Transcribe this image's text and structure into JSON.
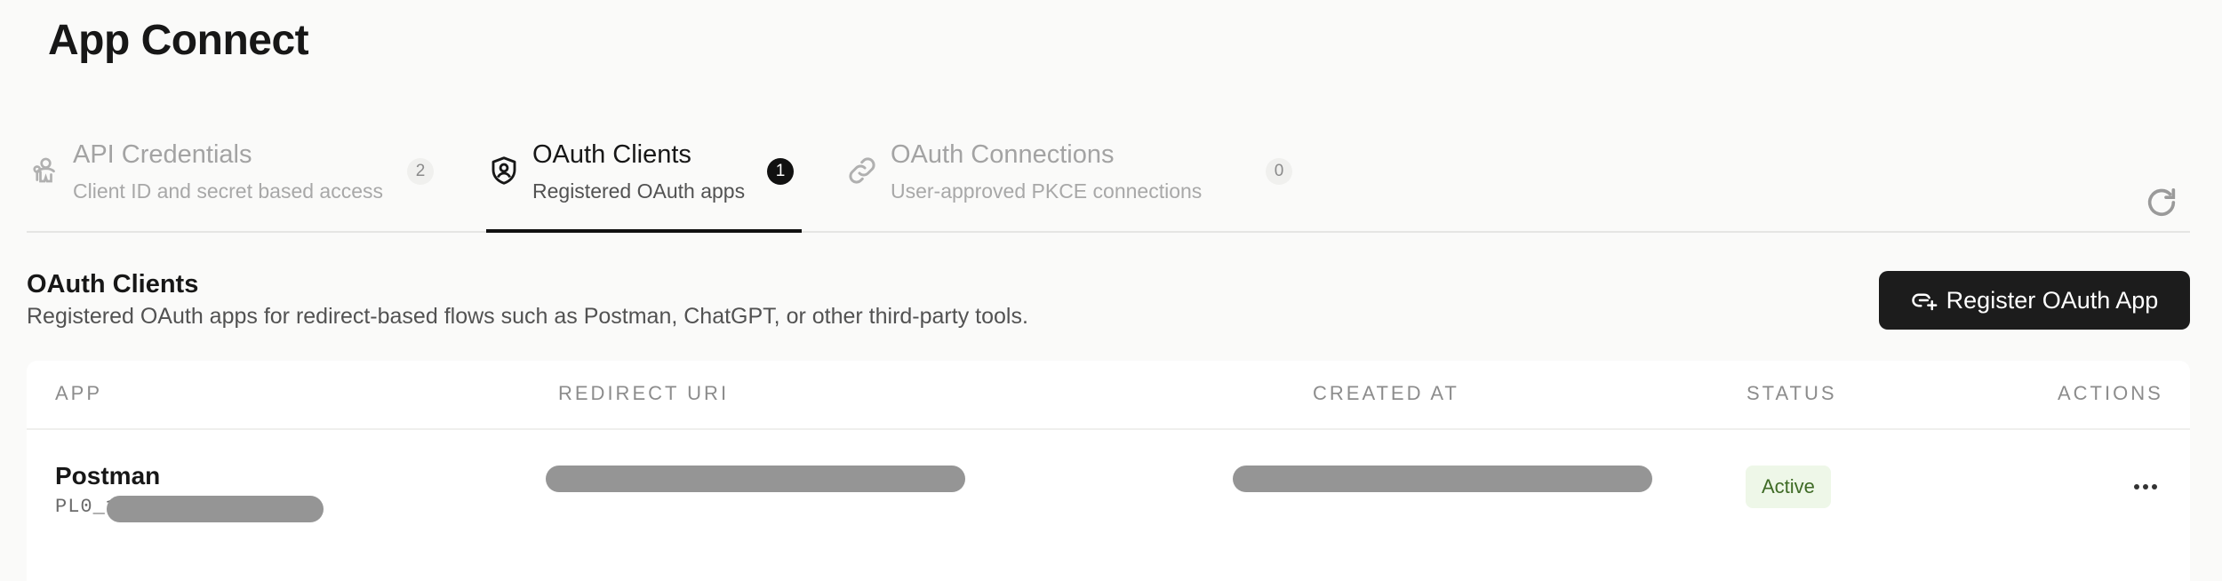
{
  "page": {
    "title": "App Connect"
  },
  "tabs": [
    {
      "title": "API Credentials",
      "subtitle": "Client ID and secret based access",
      "count": "2",
      "icon": "key-person-icon",
      "active": false
    },
    {
      "title": "OAuth Clients",
      "subtitle": "Registered OAuth apps",
      "count": "1",
      "icon": "shield-user-icon",
      "active": true
    },
    {
      "title": "OAuth Connections",
      "subtitle": "User-approved PKCE connections",
      "count": "0",
      "icon": "link-icon",
      "active": false
    }
  ],
  "section": {
    "title": "OAuth Clients",
    "description": "Registered OAuth apps for redirect-based flows such as Postman, ChatGPT, or other third-party tools.",
    "register_button_label": "Register OAuth App",
    "register_button_icon": "link-plus-icon"
  },
  "table": {
    "columns": [
      "APP",
      "REDIRECT URI",
      "CREATED AT",
      "STATUS",
      "ACTIONS"
    ],
    "rows": [
      {
        "app_name": "Postman",
        "app_id_prefix": "PL0_1",
        "status": "Active"
      }
    ]
  },
  "colors": {
    "accent": "#111111",
    "status_active_bg": "#eef7e8",
    "status_active_text": "#3f6b26",
    "redaction": "#959595"
  }
}
